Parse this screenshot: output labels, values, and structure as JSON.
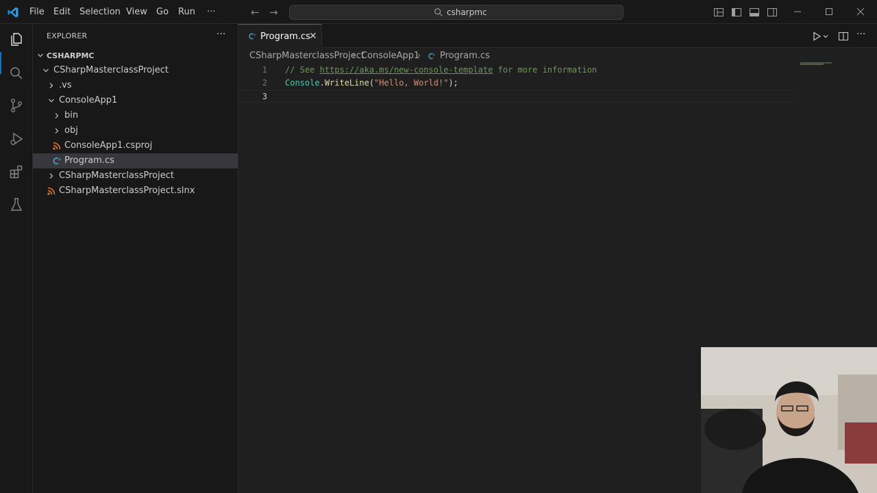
{
  "menu": [
    "File",
    "Edit",
    "Selection",
    "View",
    "Go",
    "Run",
    "···"
  ],
  "command_center": {
    "text": "csharpmc"
  },
  "sidebar": {
    "title": "EXPLORER",
    "more": "···",
    "tree": [
      {
        "label": "CSHARPMC"
      },
      {
        "label": "CSharpMasterclassProject"
      },
      {
        "label": ".vs"
      },
      {
        "label": "ConsoleApp1"
      },
      {
        "label": "bin"
      },
      {
        "label": "obj"
      },
      {
        "label": "ConsoleApp1.csproj"
      },
      {
        "label": "Program.cs"
      },
      {
        "label": "CSharpMasterclassProject"
      },
      {
        "label": "CSharpMasterclassProject.slnx"
      }
    ]
  },
  "editor": {
    "tab": {
      "label": "Program.cs",
      "close": "✕"
    },
    "breadcrumb": [
      "CSharpMasterclassProject",
      "ConsoleApp1",
      "Program.cs"
    ],
    "lines": [
      {
        "number": "1",
        "comment_prefix": "// See ",
        "link": "https://aka.ms/new-console-template",
        "comment_suffix": " for more information"
      },
      {
        "number": "2",
        "class": "Console",
        "dot": ".",
        "method": "WriteLine",
        "open": "(",
        "string": "\"Hello, World!\"",
        "close": ");"
      },
      {
        "number": "3"
      }
    ]
  },
  "colors": {
    "accent": "#0078d4",
    "background": "#1f1f1f",
    "sidebar": "#181818",
    "selected_row": "#37373d"
  },
  "icons": [
    "vscode-logo-icon",
    "explorer-icon",
    "search-icon",
    "source-control-icon",
    "run-debug-icon",
    "extensions-icon",
    "testing-icon",
    "csharp-file-icon",
    "rss-file-icon",
    "run-icon",
    "split-editor-icon"
  ]
}
